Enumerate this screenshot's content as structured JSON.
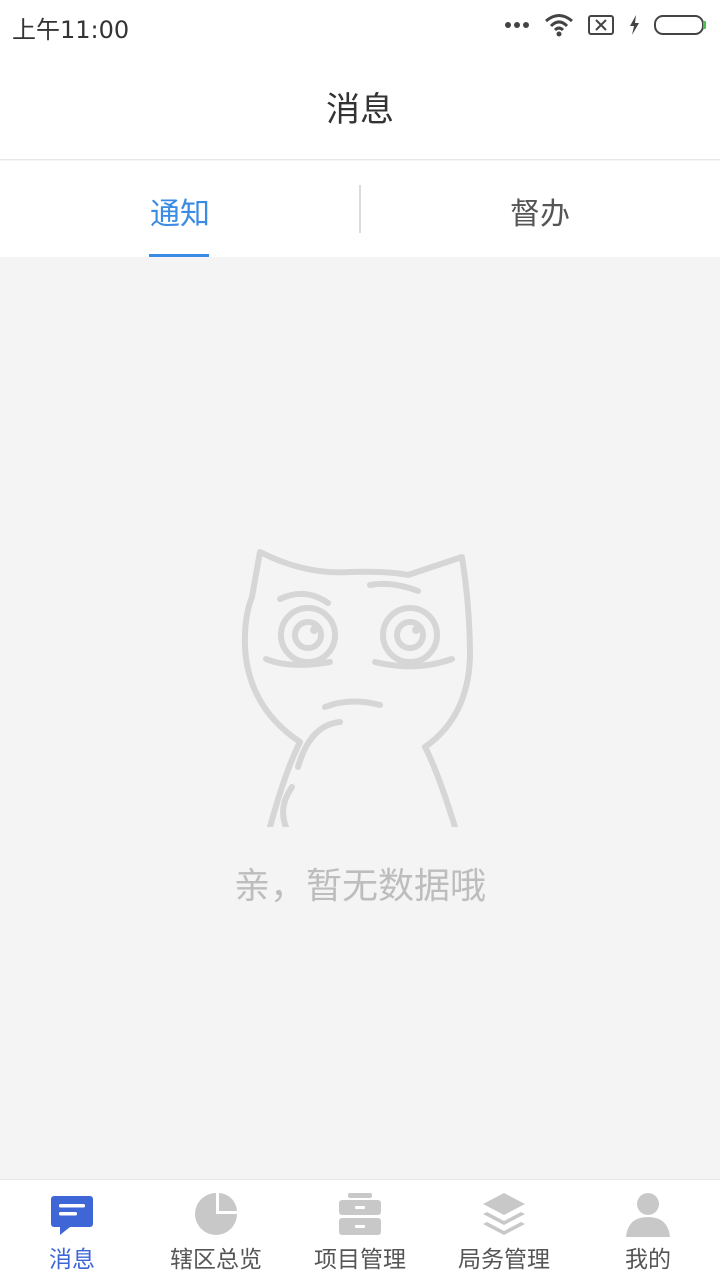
{
  "status_bar": {
    "time": "上午11:00",
    "icons": [
      "more-dots-icon",
      "wifi-icon",
      "no-sim-icon",
      "charging-icon",
      "battery-icon"
    ]
  },
  "app_bar": {
    "title": "消息"
  },
  "tabs": [
    {
      "label": "通知",
      "active": true
    },
    {
      "label": "督办",
      "active": false
    }
  ],
  "empty_state": {
    "icon": "sad-cat-illustration",
    "message": "亲，暂无数据哦"
  },
  "bottom_nav": [
    {
      "label": "消息",
      "icon": "message-icon",
      "active": true
    },
    {
      "label": "辖区总览",
      "icon": "pie-chart-icon",
      "active": false
    },
    {
      "label": "项目管理",
      "icon": "cabinet-icon",
      "active": false
    },
    {
      "label": "局务管理",
      "icon": "layers-icon",
      "active": false
    },
    {
      "label": "我的",
      "icon": "person-icon",
      "active": false
    }
  ],
  "colors": {
    "accent_tab": "#3a8be3",
    "accent_nav": "#3f66d6",
    "inactive_icon": "#c8c8c8",
    "background": "#f4f4f4"
  }
}
